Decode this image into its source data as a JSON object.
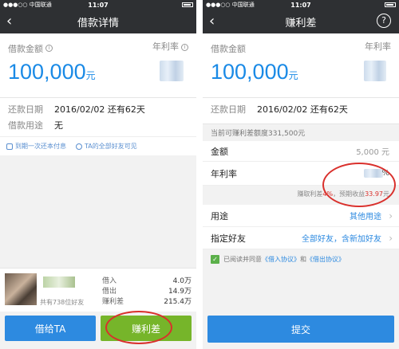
{
  "status": {
    "carrier": "●●●○○ 中国联通",
    "time": "11:07"
  },
  "left": {
    "title": "借款详情",
    "amount_label": "借款金额",
    "amount_value": "100,000",
    "amount_unit": "元",
    "rate_label": "年利率",
    "repay_label": "还款日期",
    "repay_value": "2016/02/02 还有62天",
    "purpose_label": "借款用途",
    "purpose_value": "无",
    "tip1": "到期一次还本付息",
    "tip2": "TA的全部好友可见",
    "lender_count": "共有738位好友",
    "stats": [
      {
        "label": "借入",
        "value": "4.0万"
      },
      {
        "label": "借出",
        "value": "14.9万"
      },
      {
        "label": "赚利差",
        "value": "215.4万"
      }
    ],
    "btn_lend": "借给TA",
    "btn_spread": "赚利差"
  },
  "right": {
    "title": "赚利差",
    "amount_label": "借款金额",
    "amount_value": "100,000",
    "amount_unit": "元",
    "rate_label": "年利率",
    "repay_label": "还款日期",
    "repay_value": "2016/02/02 还有62天",
    "available": "当前可赚利差额度331,500元",
    "sum_label": "金额",
    "sum_value": "5,000 元",
    "rate_row_label": "年利率",
    "rate_row_unit": "%",
    "earn_prefix": "赚取利差",
    "earn_pct": "4%",
    "earn_mid": "，预期收益",
    "earn_amount": "33.97",
    "earn_suffix": "元",
    "purpose_label": "用途",
    "purpose_value": "其他用途",
    "friend_label": "指定好友",
    "friend_value": "全部好友，含新加好友",
    "agree_prefix": "已阅读并同意",
    "agree_link1": "《借入协议》",
    "agree_and": "和",
    "agree_link2": "《借出协议》",
    "submit": "提交"
  },
  "colors": {
    "accent": "#2d8ae0",
    "green": "#76b52a",
    "red": "#d9302c"
  }
}
